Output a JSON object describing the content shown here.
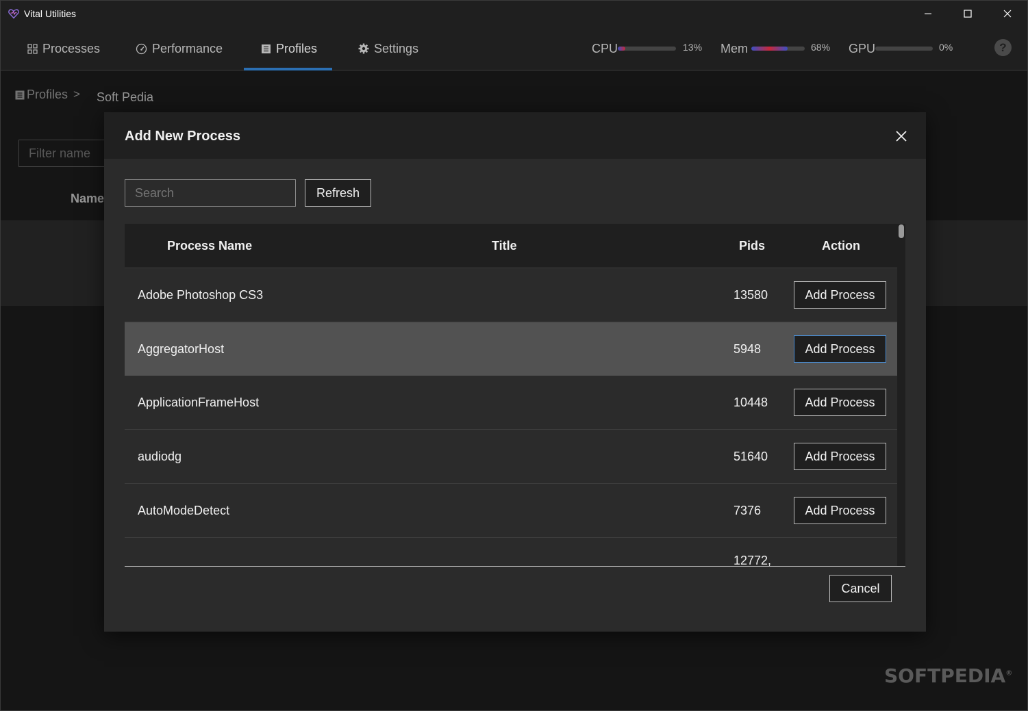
{
  "window": {
    "title": "Vital Utilities",
    "controls": {
      "minimize": "minimize-icon",
      "maximize": "maximize-icon",
      "close": "close-icon"
    }
  },
  "nav": {
    "tabs": [
      {
        "label": "Processes",
        "icon": "grid-icon"
      },
      {
        "label": "Performance",
        "icon": "gauge-icon"
      },
      {
        "label": "Profiles",
        "icon": "list-icon",
        "active": true
      },
      {
        "label": "Settings",
        "icon": "gear-icon"
      }
    ],
    "meters": {
      "cpu": {
        "label": "CPU",
        "value": "13%",
        "fraction": 0.13
      },
      "mem": {
        "label": "Mem",
        "value": "68%",
        "fraction": 0.68
      },
      "gpu": {
        "label": "GPU",
        "value": "0%",
        "fraction": 0.0
      }
    },
    "help": "?"
  },
  "page": {
    "breadcrumb": {
      "root": "Profiles",
      "separator": ">",
      "current": "Soft Pedia"
    },
    "filter_placeholder": "Filter name",
    "name_header": "Name"
  },
  "dialog": {
    "title": "Add New Process",
    "search_placeholder": "Search",
    "refresh_label": "Refresh",
    "columns": {
      "name": "Process Name",
      "title": "Title",
      "pids": "Pids",
      "action": "Action"
    },
    "rows": [
      {
        "name": "Adobe Photoshop CS3",
        "title": "",
        "pids": "13580",
        "action": "Add Process"
      },
      {
        "name": "AggregatorHost",
        "title": "",
        "pids": "5948",
        "action": "Add Process"
      },
      {
        "name": "ApplicationFrameHost",
        "title": "",
        "pids": "10448",
        "action": "Add Process"
      },
      {
        "name": "audiodg",
        "title": "",
        "pids": "51640",
        "action": "Add Process"
      },
      {
        "name": "AutoModeDetect",
        "title": "",
        "pids": "7376",
        "action": "Add Process"
      },
      {
        "name": "",
        "title": "",
        "pids": "12772,",
        "action": ""
      }
    ],
    "cancel_label": "Cancel"
  },
  "watermark": "SOFTPEDIA",
  "colors": {
    "accent": "#2b6fb3",
    "hover_row": "#525252",
    "dialog_bg": "#2b2b2b"
  }
}
